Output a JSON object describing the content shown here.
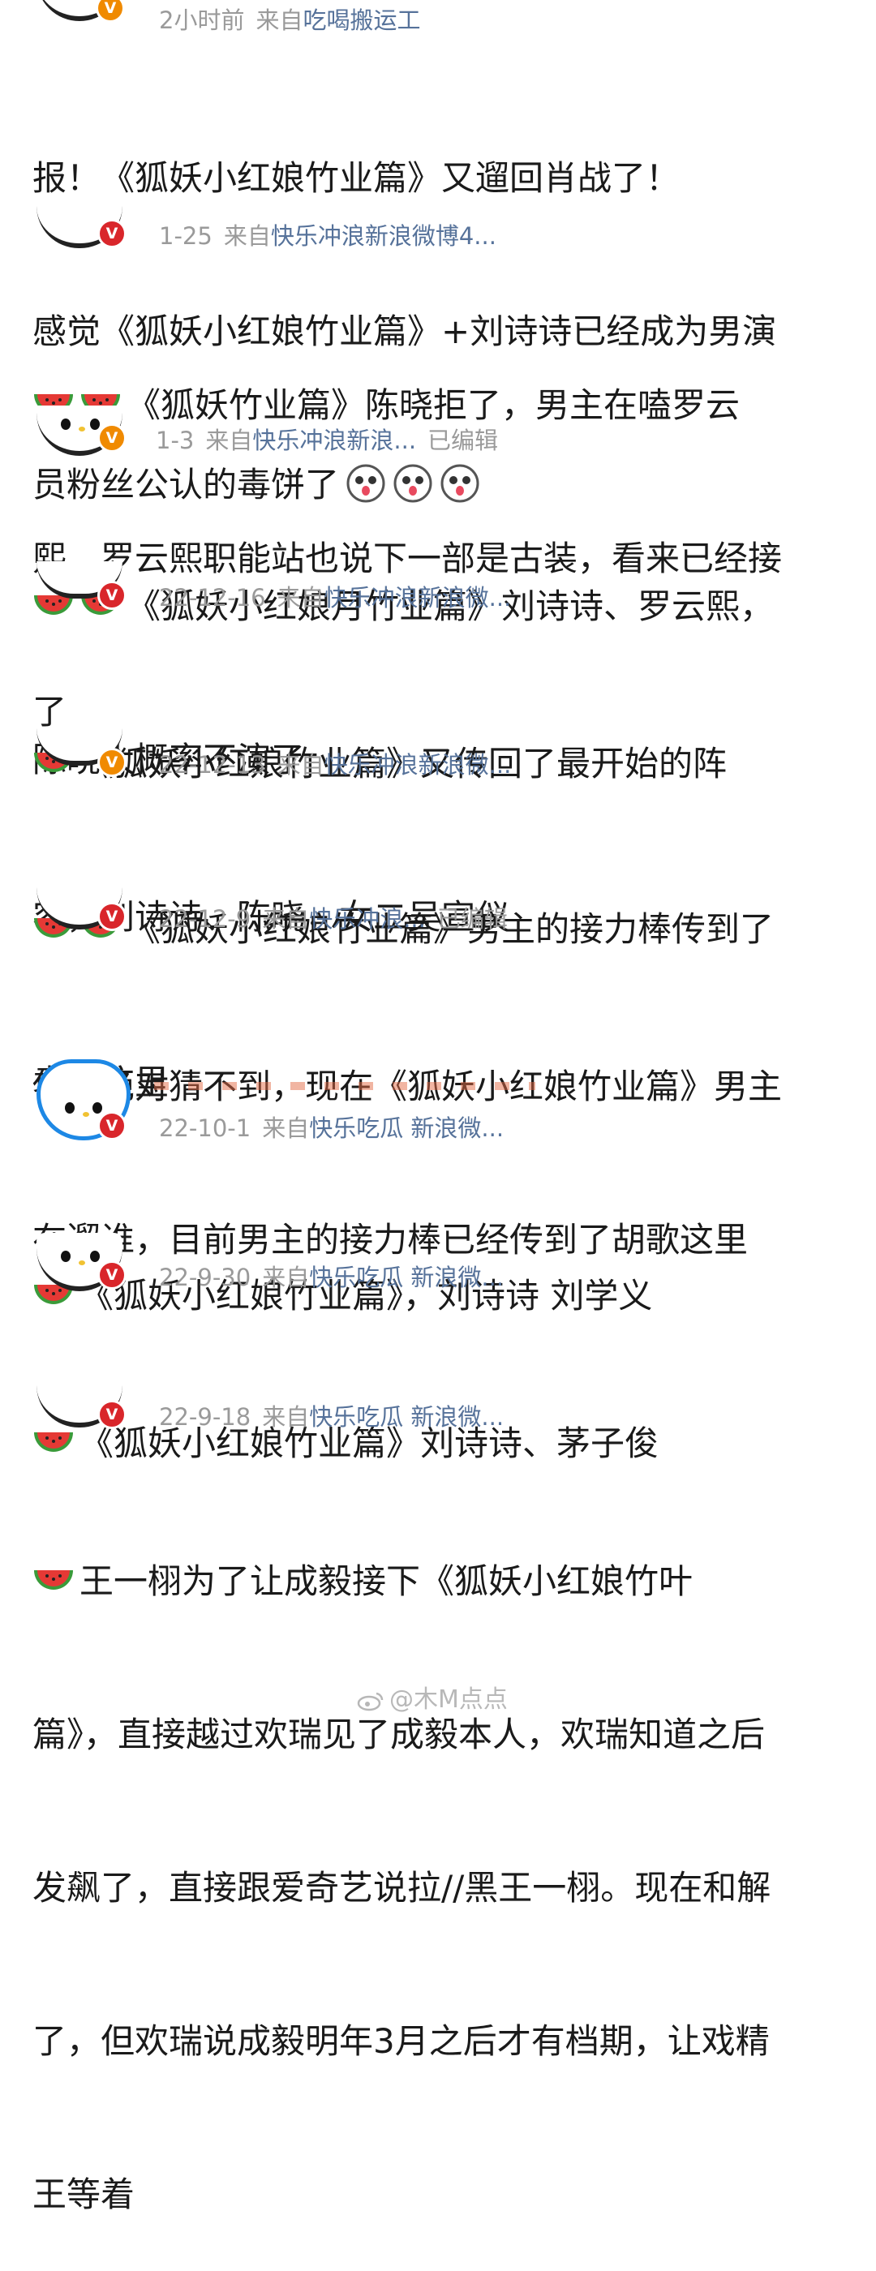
{
  "colors": {
    "meta_text": "#9a9a9a",
    "source_link": "#56729a",
    "verified_orange": "#f08a00",
    "verified_red": "#d9262b",
    "body_text": "#1a1a1a",
    "watermelon_green": "#3a9b3a",
    "watermelon_red": "#e53935"
  },
  "header": {
    "time": "2小时前",
    "from_prefix": "来自",
    "source": "吃喝搬运工"
  },
  "posts": [
    {
      "text_line1": "报！《狐妖小红娘竹业篇》又遛回肖战了！",
      "text_line2": "感觉《狐妖小红娘竹业篇》+刘诗诗已经成为男演",
      "text_line3": "员粉丝公认的毒饼了",
      "emoji": "doge-face-icon",
      "meta": {
        "date": "1-25",
        "from_prefix": "来自",
        "source": "快乐冲浪新浪微博4...",
        "edited": ""
      }
    },
    {
      "text_line1": "《狐妖竹业篇》陈晓拒了，男主在嗑罗云",
      "text_line2": "熙，罗云熙职能站也说下一部是古装，看来已经接",
      "text_line3": "了",
      "meta": {
        "date": "1-3",
        "from_prefix": "来自",
        "source": "快乐冲浪新浪...",
        "edited": "已编辑"
      }
    },
    {
      "text_line1": "《狐妖小红娘月竹业篇》刘诗诗、罗云熙，",
      "text_line2": "陈晓大概率不演了",
      "meta": {
        "date": "22-12-16",
        "from_prefix": "来自",
        "source": "快乐冲浪新浪微...",
        "edited": ""
      }
    },
    {
      "text_line1": "《狐妖小红娘竹业篇》又传回了最开始的阵",
      "text_line2": "容，刘诗诗、陈晓，女二吴宣仪",
      "meta": {
        "date": "22-12-13",
        "from_prefix": "来自",
        "source": "快乐冲浪新浪微...",
        "edited": ""
      }
    },
    {
      "text_line1": "《狐妖小红娘竹业篇》男主的接力棒传到了",
      "text_line2": "袁弘这里",
      "meta": {
        "date": "22-12-9",
        "from_prefix": "来自",
        "source": "快乐冲浪...",
        "edited": "已编辑"
      }
    },
    {
      "text_line1": "你们绝对猜不到，现在《狐妖小红娘竹业篇》男主",
      "text_line2": "在遛谁，目前男主的接力棒已经传到了胡歌这里",
      "meta": {
        "date": "22-10-1",
        "from_prefix": "来自",
        "source": "快乐吃瓜 新浪微...",
        "edited": ""
      }
    },
    {
      "text_line1": "《狐妖小红娘竹业篇》，刘诗诗 刘学义",
      "meta": {
        "date": "22-9-30",
        "from_prefix": "来自",
        "source": "快乐吃瓜 新浪微...",
        "edited": ""
      }
    },
    {
      "text_line1": "《狐妖小红娘竹业篇》刘诗诗、茅子俊",
      "meta": {
        "date": "22-9-18",
        "from_prefix": "来自",
        "source": "快乐吃瓜 新浪微...",
        "edited": ""
      }
    },
    {
      "text_line1": "王一栩为了让成毅接下《狐妖小红娘竹叶",
      "text_line2": "篇》，直接越过欢瑞见了成毅本人，欢瑞知道之后",
      "text_line3": "发飙了，直接跟爱奇艺说拉//黑王一栩。现在和解",
      "text_line4": "了，但欢瑞说成毅明年3月之后才有档期，让戏精",
      "text_line5": "王等着"
    }
  ],
  "watermark": {
    "text": "@木M点点",
    "icon": "weibo-icon"
  }
}
